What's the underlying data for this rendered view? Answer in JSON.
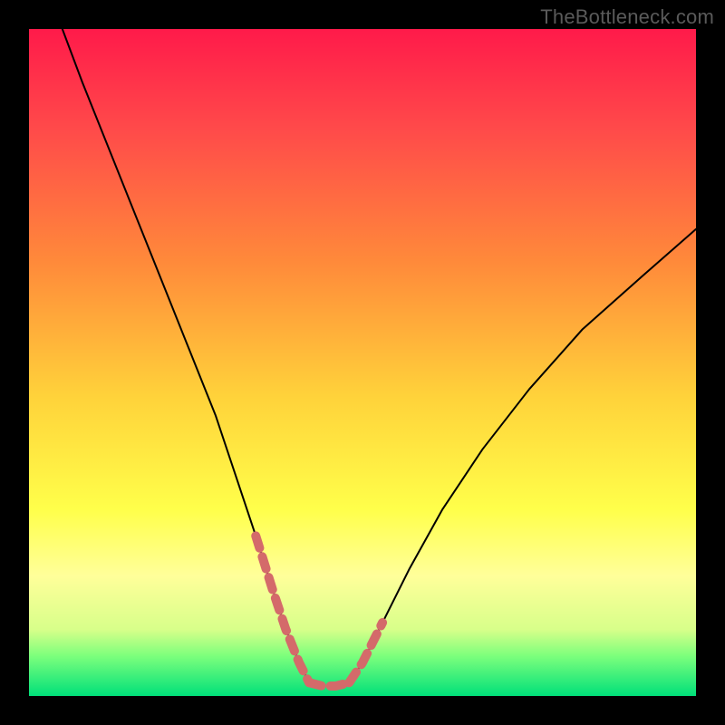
{
  "watermark": "TheBottleneck.com",
  "chart_data": {
    "type": "line",
    "title": "",
    "xlabel": "",
    "ylabel": "",
    "xlim": [
      0,
      100
    ],
    "ylim": [
      0,
      100
    ],
    "grid": false,
    "legend": false,
    "background_gradient": {
      "stops": [
        {
          "offset": 0.0,
          "color": "#ff1a4a"
        },
        {
          "offset": 0.15,
          "color": "#ff4a4a"
        },
        {
          "offset": 0.35,
          "color": "#ff8a3a"
        },
        {
          "offset": 0.55,
          "color": "#ffd23a"
        },
        {
          "offset": 0.72,
          "color": "#ffff4a"
        },
        {
          "offset": 0.82,
          "color": "#ffff9a"
        },
        {
          "offset": 0.9,
          "color": "#d8ff8a"
        },
        {
          "offset": 0.94,
          "color": "#7cff7c"
        },
        {
          "offset": 1.0,
          "color": "#00e07a"
        }
      ]
    },
    "series": [
      {
        "name": "curve-left",
        "color": "#000000",
        "width": 2,
        "x": [
          5,
          8,
          12,
          16,
          20,
          24,
          28,
          31,
          34,
          36.5,
          38.5,
          40.5,
          42
        ],
        "y": [
          100,
          92,
          82,
          72,
          62,
          52,
          42,
          33,
          24,
          16,
          10,
          5,
          2
        ]
      },
      {
        "name": "curve-right",
        "color": "#000000",
        "width": 2,
        "x": [
          48,
          50,
          53,
          57,
          62,
          68,
          75,
          83,
          92,
          100
        ],
        "y": [
          2,
          5,
          11,
          19,
          28,
          37,
          46,
          55,
          63,
          70
        ]
      },
      {
        "name": "highlight-left",
        "color": "#d46a6a",
        "width": 10,
        "dash": true,
        "x": [
          34,
          36.5,
          38.5,
          40.5,
          42
        ],
        "y": [
          24,
          16,
          10,
          5,
          2
        ]
      },
      {
        "name": "highlight-bottom",
        "color": "#d46a6a",
        "width": 10,
        "dash": true,
        "x": [
          42,
          44,
          46,
          48
        ],
        "y": [
          2,
          1.5,
          1.5,
          2
        ]
      },
      {
        "name": "highlight-right",
        "color": "#d46a6a",
        "width": 10,
        "dash": true,
        "x": [
          48,
          50,
          53
        ],
        "y": [
          2,
          5,
          11
        ]
      }
    ]
  }
}
